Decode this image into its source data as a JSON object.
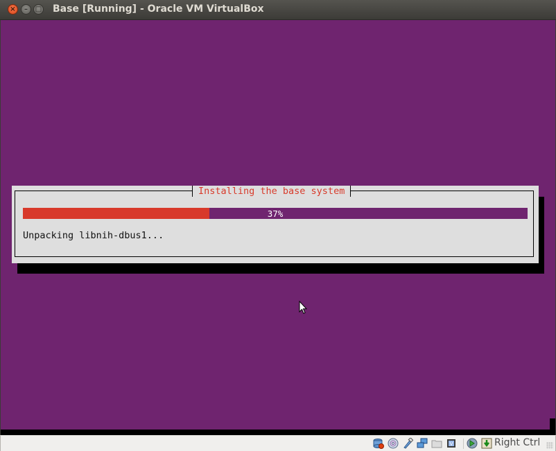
{
  "window": {
    "title": "Base [Running] - Oracle VM VirtualBox",
    "buttons": {
      "close": "×",
      "minimize": "–",
      "maximize": "□"
    }
  },
  "installer": {
    "dialog_title": "Installing the base system",
    "progress_percent": 37,
    "progress_label": "37%",
    "status_text": "Unpacking libnih-dbus1..."
  },
  "colors": {
    "background": "#6f246f",
    "progress_fill": "#d8392b",
    "dialog_title": "#d83b2b",
    "dialog_bg": "#dedede"
  },
  "statusbar": {
    "icons": [
      "hard-disk-icon",
      "optical-drive-icon",
      "usb-icon",
      "network-icon",
      "shared-folders-icon",
      "virtualization-icon",
      "mouse-integration-icon",
      "keyboard-capture-icon"
    ],
    "host_key": "Right Ctrl"
  }
}
